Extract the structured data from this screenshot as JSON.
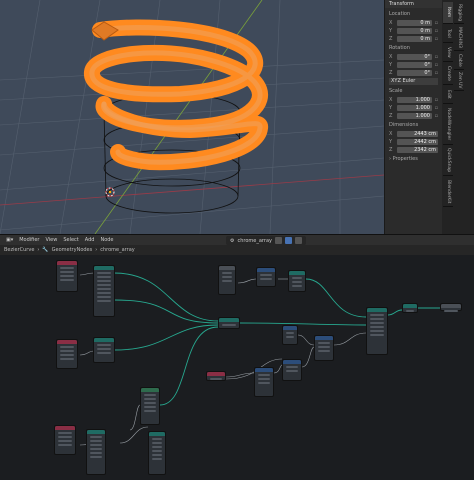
{
  "npanel": {
    "title": "Transform",
    "location_label": "Location",
    "location": [
      {
        "axis": "X",
        "value": "0 m"
      },
      {
        "axis": "Y",
        "value": "0 m"
      },
      {
        "axis": "Z",
        "value": "0 m"
      }
    ],
    "rotation_label": "Rotation",
    "rotation": [
      {
        "axis": "X",
        "value": "0°"
      },
      {
        "axis": "Y",
        "value": "0°"
      },
      {
        "axis": "Z",
        "value": "0°"
      }
    ],
    "rotation_mode": "XYZ Euler",
    "scale_label": "Scale",
    "scale": [
      {
        "axis": "X",
        "value": "1.000"
      },
      {
        "axis": "Y",
        "value": "1.000"
      },
      {
        "axis": "Z",
        "value": "1.000"
      }
    ],
    "dimensions_label": "Dimensions",
    "dimensions": [
      {
        "axis": "X",
        "value": "2443 cm"
      },
      {
        "axis": "Y",
        "value": "2442 cm"
      },
      {
        "axis": "Z",
        "value": "2342 cm"
      }
    ],
    "properties_label": "Properties"
  },
  "vtabs": [
    "Item",
    "Tool",
    "View",
    "Create",
    "Edit",
    "NodeWrangler",
    "QuickSnap",
    "BlenderKit",
    "Rigging",
    "MACHIN3",
    "Cable",
    "Zen UV"
  ],
  "node_editor": {
    "header": {
      "editor_label": "Modifier",
      "menus": [
        "View",
        "Select",
        "Add",
        "Node"
      ],
      "tree_name": "chrome_array"
    },
    "breadcrumb": [
      "BezierCurve",
      "GeometryNodes",
      "chrome_array"
    ]
  }
}
